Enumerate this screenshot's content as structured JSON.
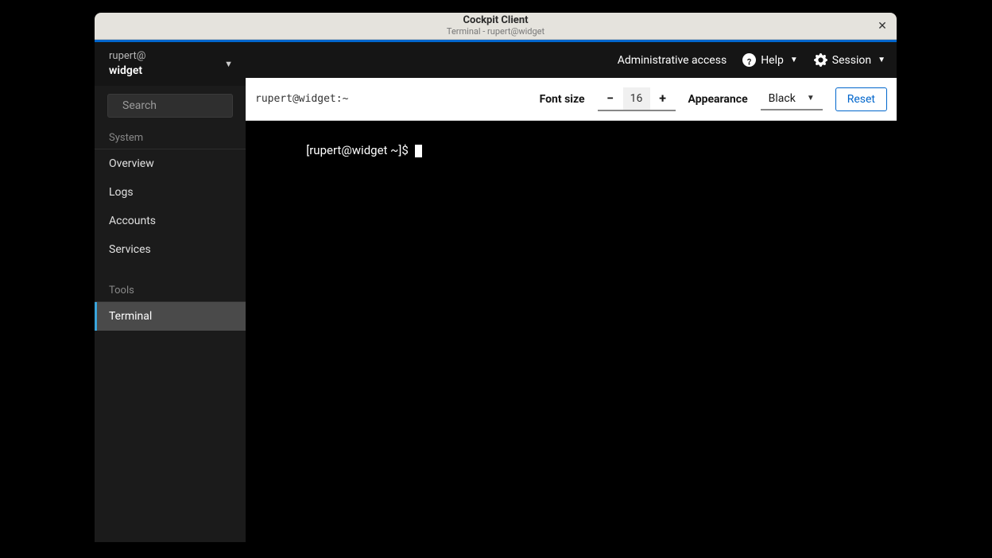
{
  "titlebar": {
    "app": "Cockpit Client",
    "subtitle": "Terminal - rupert@widget"
  },
  "sidebar": {
    "host_user": "rupert@",
    "host_name": "widget",
    "search_placeholder": "Search",
    "group_system": "System",
    "items_system": [
      {
        "label": "Overview"
      },
      {
        "label": "Logs"
      },
      {
        "label": "Accounts"
      },
      {
        "label": "Services"
      }
    ],
    "group_tools": "Tools",
    "items_tools": [
      {
        "label": "Terminal",
        "active": true
      }
    ]
  },
  "topbar": {
    "admin": "Administrative access",
    "help": "Help",
    "session": "Session"
  },
  "controls": {
    "path": "rupert@widget:~",
    "font_label": "Font size",
    "font_value": "16",
    "appearance_label": "Appearance",
    "appearance_value": "Black",
    "reset": "Reset"
  },
  "terminal": {
    "prompt": "[rupert@widget ~]$ "
  }
}
